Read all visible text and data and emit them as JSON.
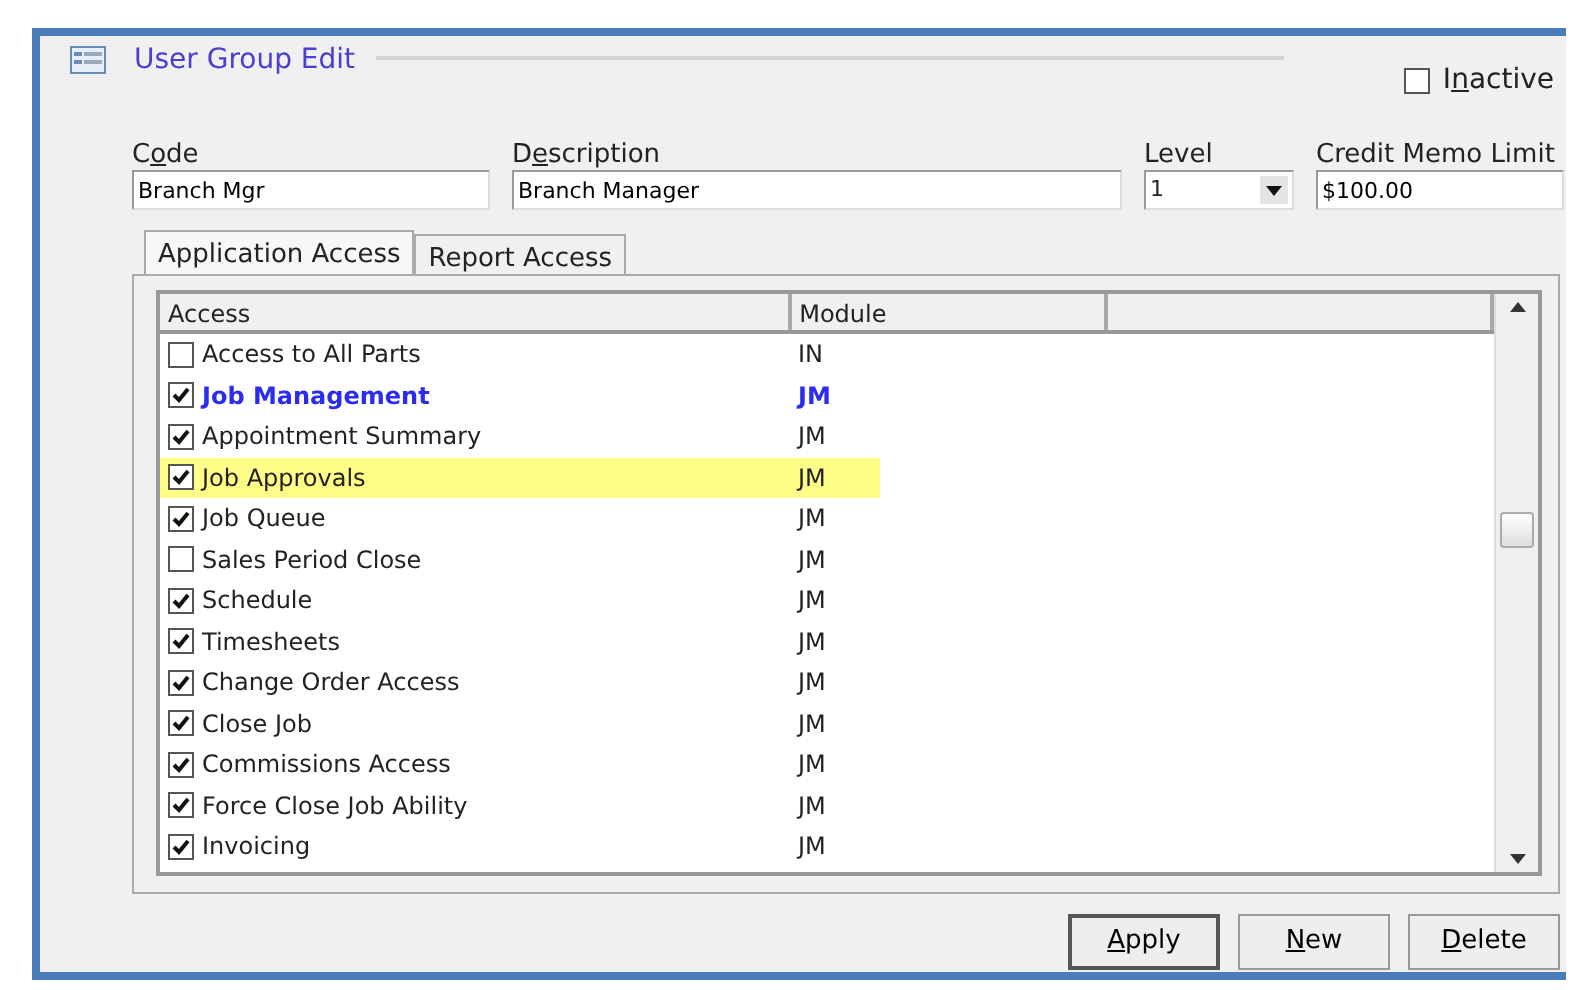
{
  "window": {
    "title": "User Group Edit"
  },
  "inactive": {
    "label_parts": [
      {
        "text": "I",
        "underlined": false
      },
      {
        "text": "n",
        "underlined": true
      },
      {
        "text": "active",
        "underlined": false
      }
    ],
    "checked": false
  },
  "fields": [
    {
      "label_parts": [
        {
          "text": "C",
          "underlined": false
        },
        {
          "text": "o",
          "underlined": true
        },
        {
          "text": "de",
          "underlined": false
        }
      ],
      "kind": "text",
      "value": "Branch Mgr"
    },
    {
      "label_parts": [
        {
          "text": "D",
          "underlined": false
        },
        {
          "text": "e",
          "underlined": true
        },
        {
          "text": "scription",
          "underlined": false
        }
      ],
      "kind": "text",
      "value": "Branch Manager"
    },
    {
      "label_parts": [
        {
          "text": "Level",
          "underlined": false
        }
      ],
      "kind": "dropdown",
      "value": "1"
    },
    {
      "label_parts": [
        {
          "text": "Credit Memo Limit",
          "underlined": false
        }
      ],
      "kind": "text",
      "value": "$100.00"
    }
  ],
  "tabs": [
    {
      "label": "Application Access",
      "selected": true
    },
    {
      "label": "Report Access",
      "selected": false
    }
  ],
  "table": {
    "columns": [
      "Access",
      "Module"
    ],
    "rows": [
      {
        "access": "Access to All Parts",
        "module": "IN",
        "checked": false,
        "kind": "item",
        "highlighted": false
      },
      {
        "access": "Job Management",
        "module": "JM",
        "checked": true,
        "kind": "group",
        "highlighted": false
      },
      {
        "access": "Appointment Summary",
        "module": "JM",
        "checked": true,
        "kind": "item",
        "highlighted": false
      },
      {
        "access": "Job Approvals",
        "module": "JM",
        "checked": true,
        "kind": "item",
        "highlighted": true
      },
      {
        "access": "Job Queue",
        "module": "JM",
        "checked": true,
        "kind": "item",
        "highlighted": false
      },
      {
        "access": "Sales Period Close",
        "module": "JM",
        "checked": false,
        "kind": "item",
        "highlighted": false
      },
      {
        "access": "Schedule",
        "module": "JM",
        "checked": true,
        "kind": "item",
        "highlighted": false
      },
      {
        "access": "Timesheets",
        "module": "JM",
        "checked": true,
        "kind": "item",
        "highlighted": false
      },
      {
        "access": "Change Order Access",
        "module": "JM",
        "checked": true,
        "kind": "item",
        "highlighted": false
      },
      {
        "access": "Close Job",
        "module": "JM",
        "checked": true,
        "kind": "item",
        "highlighted": false
      },
      {
        "access": "Commissions Access",
        "module": "JM",
        "checked": true,
        "kind": "item",
        "highlighted": false
      },
      {
        "access": "Force Close Job Ability",
        "module": "JM",
        "checked": true,
        "kind": "item",
        "highlighted": false
      },
      {
        "access": "Invoicing",
        "module": "JM",
        "checked": true,
        "kind": "item",
        "highlighted": false
      }
    ]
  },
  "buttons": [
    {
      "label_parts": [
        {
          "text": "A",
          "underlined": true
        },
        {
          "text": "pply",
          "underlined": false
        }
      ],
      "default": true
    },
    {
      "label_parts": [
        {
          "text": "N",
          "underlined": true
        },
        {
          "text": "ew",
          "underlined": false
        }
      ],
      "default": false
    },
    {
      "label_parts": [
        {
          "text": "D",
          "underlined": true
        },
        {
          "text": "elete",
          "underlined": false
        }
      ],
      "default": false
    }
  ]
}
